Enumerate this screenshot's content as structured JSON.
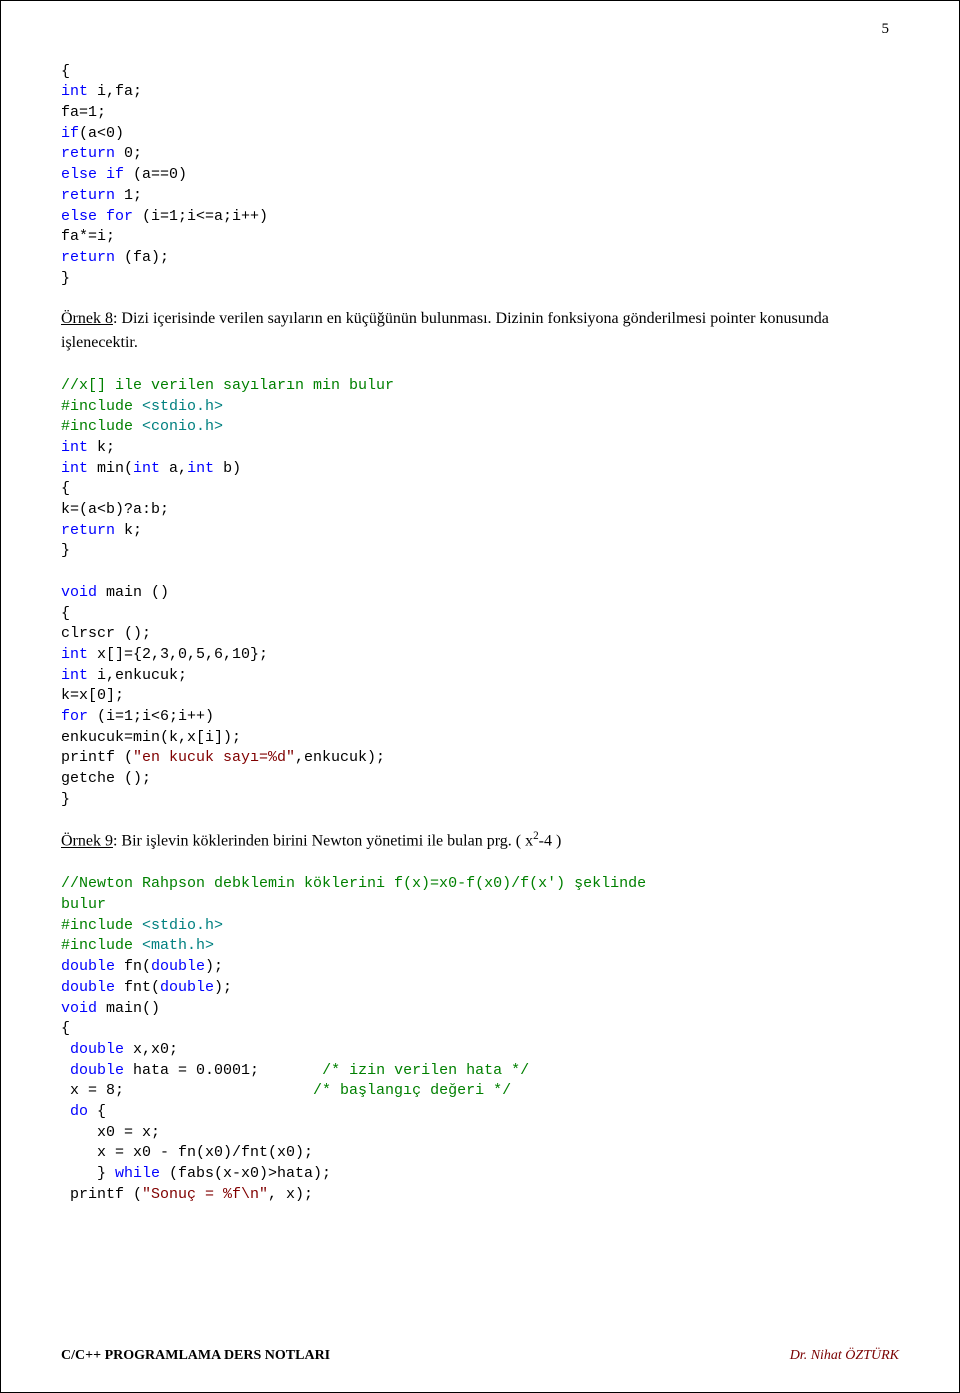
{
  "pageNumber": "5",
  "block1": {
    "l01": "{",
    "l02a": "int",
    "l02b": " i,fa;",
    "l03": "fa=1;",
    "l04a": "if",
    "l04b": "(a<0)",
    "l05a": "return",
    "l05b": " 0;",
    "l06a": "else",
    "l06b": " if",
    "l06c": " (a==0)",
    "l07a": "return",
    "l07b": " 1;",
    "l08a": "else",
    "l08b": " for",
    "l08c": " (i=1;i<=a;i++)",
    "l09": "fa*=i;",
    "l10a": "return",
    "l10b": " (fa);",
    "l11": "}"
  },
  "para1a": "Örnek 8",
  "para1b": ": Dizi içerisinde verilen sayıların en küçüğünün bulunması. Dizinin fonksiyona gönderilmesi pointer konusunda işlenecektir.",
  "block2": {
    "c01": "//x[] ile verilen sayıların min bulur",
    "c02a": "#include",
    "c02b": " <stdio.h>",
    "c03a": "#include",
    "c03b": " <conio.h>",
    "c04a": "int",
    "c04b": " k;",
    "c05a": "int",
    "c05b": " min(",
    "c05c": "int",
    "c05d": " a,",
    "c05e": "int",
    "c05f": " b)",
    "c06": "{",
    "c07": "k=(a<b)?a:b;",
    "c08a": "return",
    "c08b": " k;",
    "c09": "}",
    "blank": " ",
    "c10a": "void",
    "c10b": " main ()",
    "c11": "{",
    "c12": "clrscr ();",
    "c13a": "int",
    "c13b": " x[]={2,3,0,5,6,10};",
    "c14a": "int",
    "c14b": " i,enkucuk;",
    "c15": "k=x[0];",
    "c16a": "for",
    "c16b": " (i=1;i<6;i++)",
    "c17": "enkucuk=min(k,x[i]);",
    "c18a": "printf (",
    "c18b": "\"en kucuk sayı=%d\"",
    "c18c": ",enkucuk);",
    "c19": "getche ();",
    "c20": "}"
  },
  "para2a": "Örnek 9",
  "para2b": ": Bir işlevin köklerinden birini Newton yönetimi ile bulan prg. ( x",
  "para2sup": "2",
  "para2c": "-4 )",
  "block3": {
    "d01a": "//Newton Rahpson debklemin köklerini f(x)=x0-f(x0)/f(x') şeklinde",
    "d01b": "bulur",
    "d02a": "#include",
    "d02b": " <stdio.h>",
    "d03a": "#include",
    "d03b": " <math.h>",
    "d04a": "double",
    "d04b": " fn(",
    "d04c": "double",
    "d04d": ");",
    "d05a": "double",
    "d05b": " fnt(",
    "d05c": "double",
    "d05d": ");",
    "d06a": "void",
    "d06b": " main()",
    "d07": "{",
    "d08a": " double",
    "d08b": " x,x0;",
    "d09a": " double",
    "d09b": " hata = 0.0001;       ",
    "d09c": "/* izin verilen hata */",
    "d10a": " x = 8;                     ",
    "d10b": "/* başlangıç değeri */",
    "d11a": " do",
    "d11b": " {",
    "d12": "    x0 = x;",
    "d13": "    x = x0 - fn(x0)/fnt(x0);",
    "d14a": "    } ",
    "d14b": "while",
    "d14c": " (fabs(x-x0)>hata);",
    "d15a": " printf (",
    "d15b": "\"Sonuç = %f\\n\"",
    "d15c": ", x);"
  },
  "footer": {
    "left": "C/C++ PROGRAMLAMA DERS NOTLARI",
    "right": "Dr. Nihat ÖZTÜRK"
  }
}
